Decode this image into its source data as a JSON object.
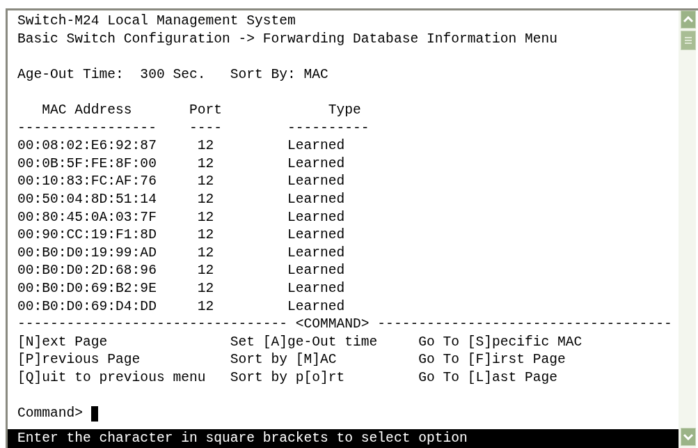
{
  "terminal": {
    "title_lines": [
      "Switch-M24 Local Management System",
      "Basic Switch Configuration -> Forwarding Database Information Menu"
    ],
    "age_out": "Age-Out Time:  300 Sec.",
    "sort_by": "Sort By: MAC",
    "table": {
      "columns": [
        "MAC Address",
        "Port",
        "Type"
      ],
      "underlines": [
        "-----------------",
        "----",
        "----------"
      ],
      "rows": [
        {
          "mac": "00:08:02:E6:92:87",
          "port": "12",
          "type": "Learned"
        },
        {
          "mac": "00:0B:5F:FE:8F:00",
          "port": "12",
          "type": "Learned"
        },
        {
          "mac": "00:10:83:FC:AF:76",
          "port": "12",
          "type": "Learned"
        },
        {
          "mac": "00:50:04:8D:51:14",
          "port": "12",
          "type": "Learned"
        },
        {
          "mac": "00:80:45:0A:03:7F",
          "port": "12",
          "type": "Learned"
        },
        {
          "mac": "00:90:CC:19:F1:8D",
          "port": "12",
          "type": "Learned"
        },
        {
          "mac": "00:B0:D0:19:99:AD",
          "port": "12",
          "type": "Learned"
        },
        {
          "mac": "00:B0:D0:2D:68:96",
          "port": "12",
          "type": "Learned"
        },
        {
          "mac": "00:B0:D0:69:B2:9E",
          "port": "12",
          "type": "Learned"
        },
        {
          "mac": "00:B0:D0:69:D4:DD",
          "port": "12",
          "type": "Learned"
        }
      ]
    },
    "command_rule": {
      "left": "---------------------------------",
      "label": "<COMMAND>",
      "right": "------------------------------------"
    },
    "options": [
      [
        "[N]ext Page",
        "Set [A]ge-Out time",
        "Go To [S]pecific MAC"
      ],
      [
        "[P]revious Page",
        "Sort by [M]AC",
        "Go To [F]irst Page"
      ],
      [
        "[Q]uit to previous menu",
        "Sort by p[o]rt",
        "Go To [L]ast Page"
      ]
    ],
    "prompt": "Command>",
    "status_bar": "Enter the character in square brackets to select option"
  }
}
